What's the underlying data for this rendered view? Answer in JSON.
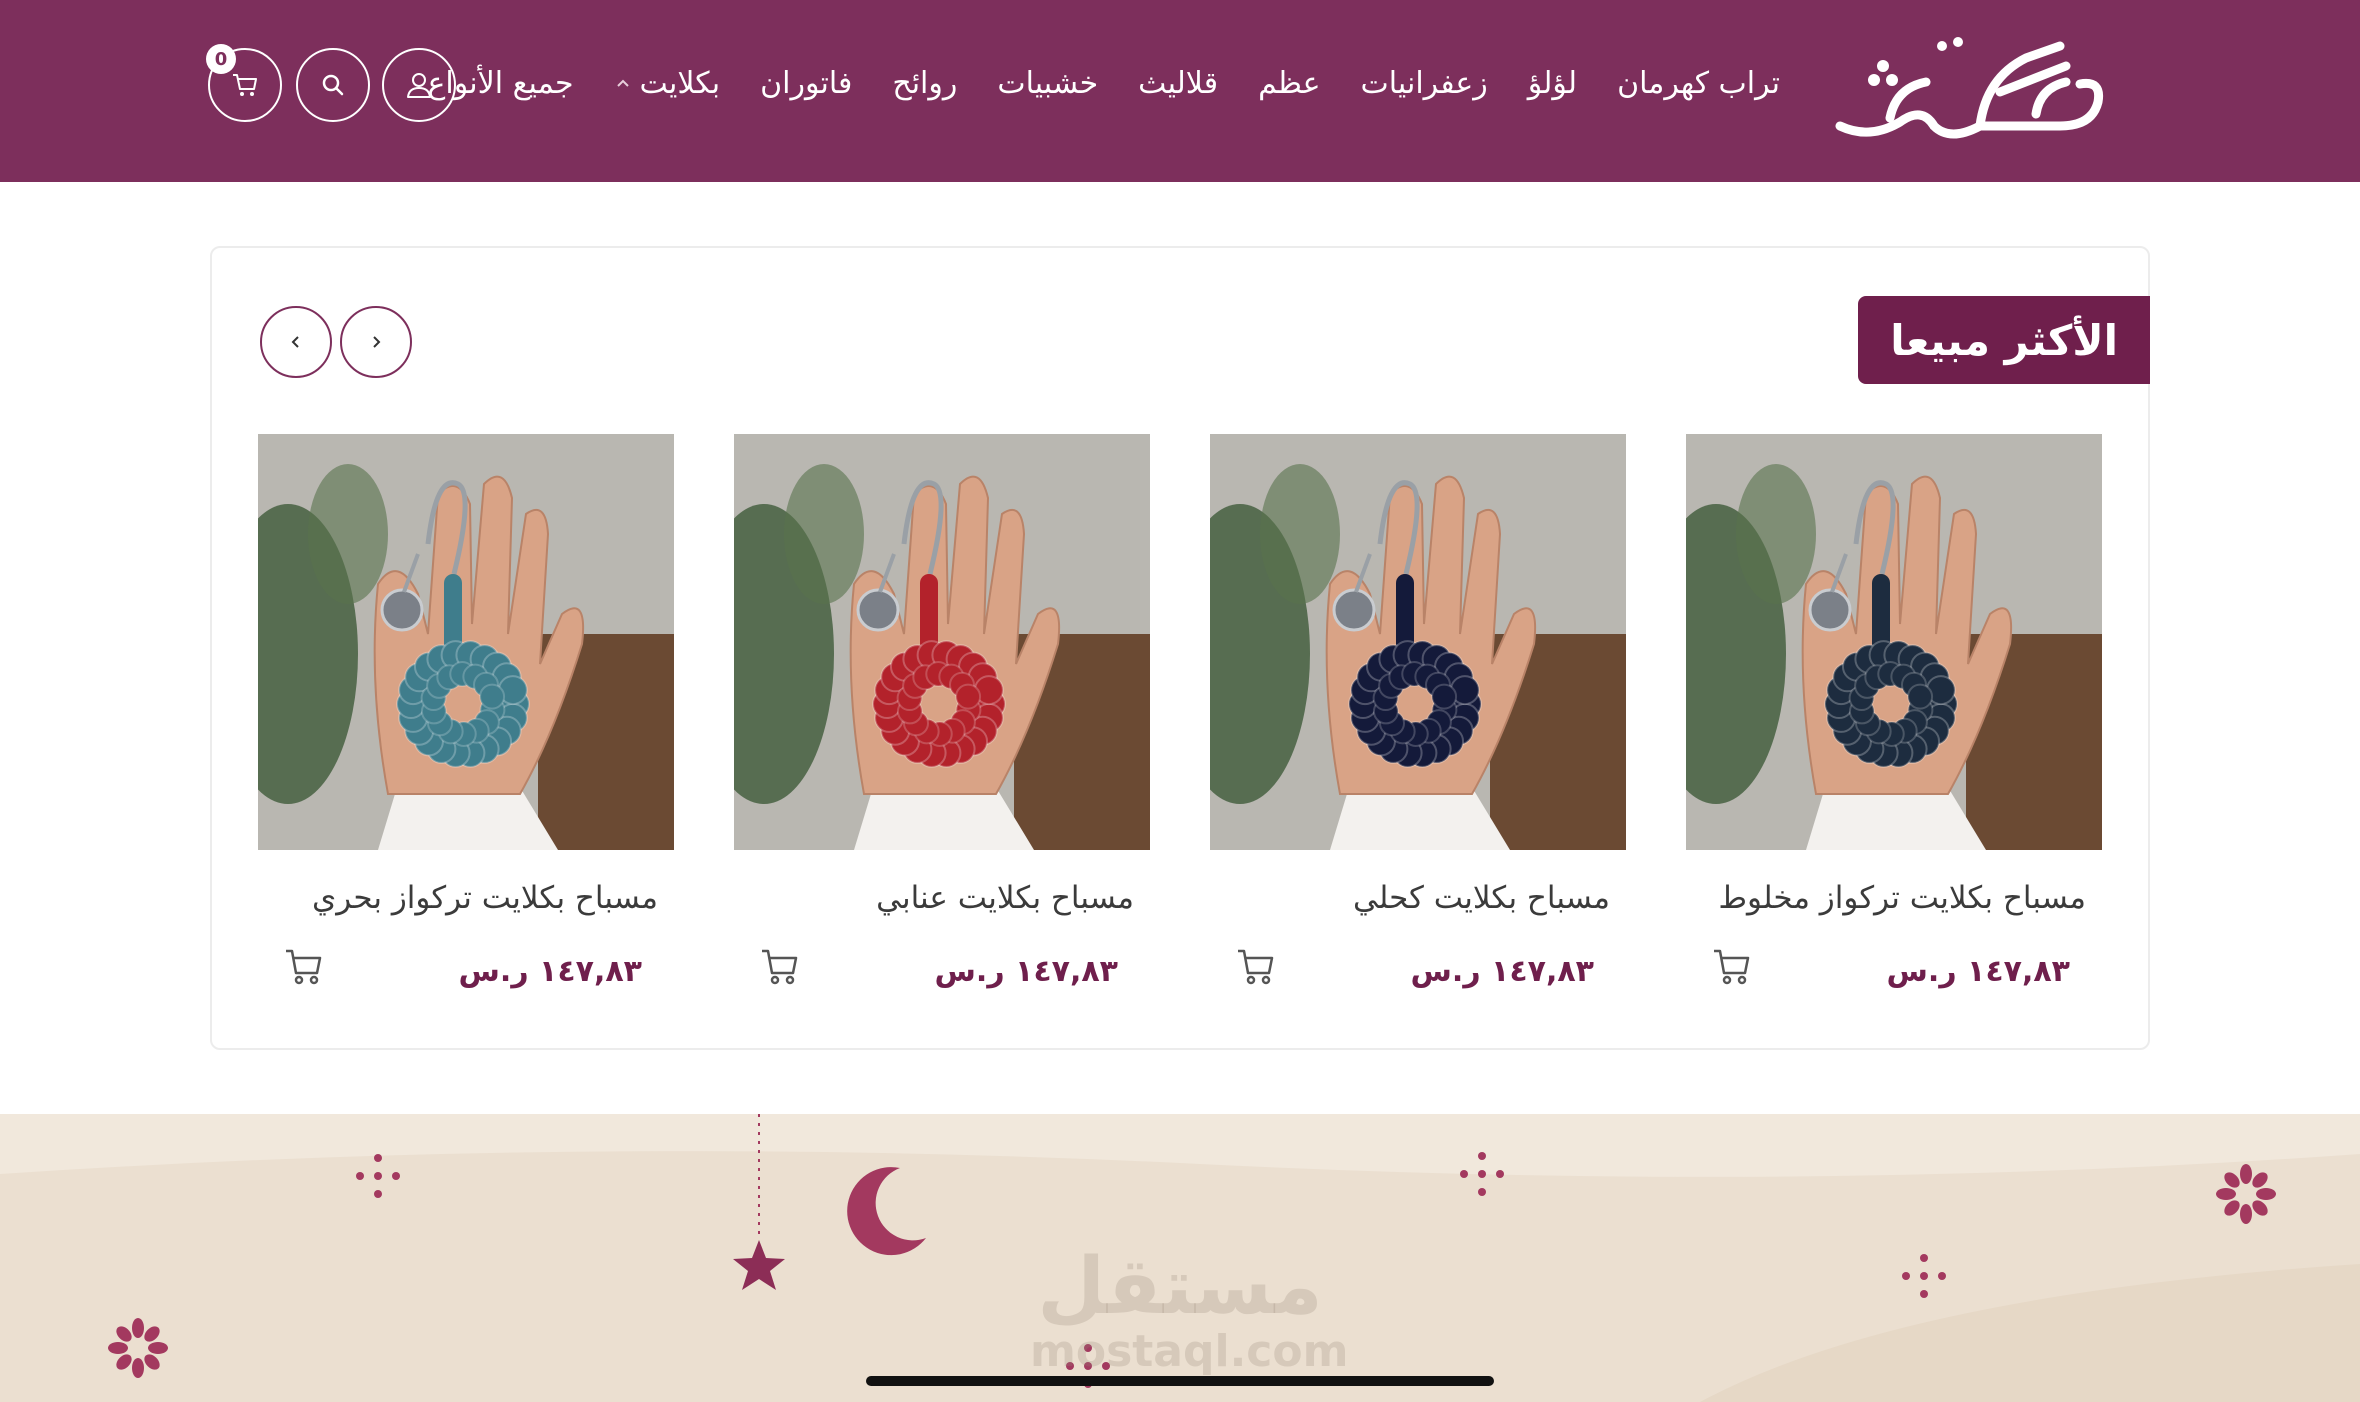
{
  "header": {
    "logo_text": "شكة",
    "nav": [
      {
        "label": "جميع الأنواع"
      },
      {
        "label": "بكلايت",
        "has_dropdown": true
      },
      {
        "label": "فاتوران"
      },
      {
        "label": "روائح"
      },
      {
        "label": "خشبيات"
      },
      {
        "label": "قلاليث"
      },
      {
        "label": "عظم"
      },
      {
        "label": "زعفرانيات"
      },
      {
        "label": "لؤلؤ"
      },
      {
        "label": "تراب كهرمان"
      }
    ],
    "account_icon": "user-icon",
    "search_icon": "search-icon",
    "cart_icon": "cart-icon",
    "cart_count": "0"
  },
  "best_sellers": {
    "title": "الأكثر مبيعا",
    "products": [
      {
        "name": "مسباح بكلايت تركواز مخلوط",
        "price": "١٤٧,٨٣ ر.س",
        "bead_color": "#1d2c3f"
      },
      {
        "name": "مسباح بكلايت كحلي",
        "price": "١٤٧,٨٣ ر.س",
        "bead_color": "#141a3a"
      },
      {
        "name": "مسباح بكلايت عنابي",
        "price": "١٤٧,٨٣ ر.س",
        "bead_color": "#b3222b"
      },
      {
        "name": "مسباح بكلايت تركواز بحري",
        "price": "١٤٧,٨٣ ر.س",
        "bead_color": "#3f7d8c"
      }
    ]
  },
  "watermark": {
    "arabic": "مستقل",
    "latin": "mostaql.com"
  },
  "colors": {
    "brand": "#7d2f5c",
    "title_bg": "#6f1f4c",
    "banner_bg": "#ebdfd0"
  }
}
